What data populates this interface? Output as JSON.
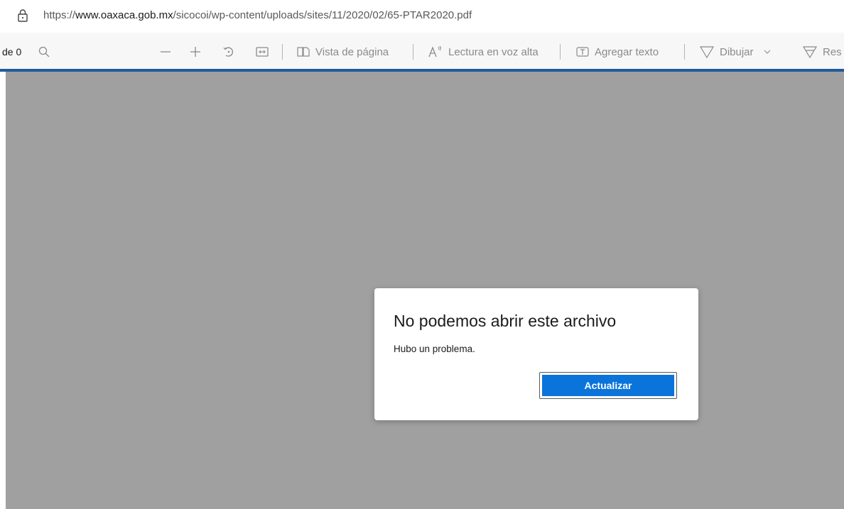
{
  "address_bar": {
    "url_prefix": "https://",
    "url_domain": "www.oaxaca.gob.mx",
    "url_path": "/sicocoi/wp-content/uploads/sites/11/2020/02/65-PTAR2020.pdf",
    "lock_icon": "lock-icon"
  },
  "toolbar": {
    "page_counter": "de 0",
    "search_icon": "search-icon",
    "zoom_out_icon": "minus-icon",
    "zoom_in_icon": "plus-icon",
    "rotate_icon": "rotate-icon",
    "fit_icon": "fit-to-width-icon",
    "page_view_label": "Vista de página",
    "read_aloud_label": "Lectura en voz alta",
    "add_text_label": "Agregar texto",
    "draw_label": "Dibujar",
    "highlight_label": "Res"
  },
  "colors": {
    "accent_line": "#1f5a9c",
    "viewer_background": "#a0a0a0",
    "primary_button": "#0a74da"
  },
  "dialog": {
    "title": "No podemos abrir este archivo",
    "message": "Hubo un problema.",
    "button_label": "Actualizar"
  }
}
